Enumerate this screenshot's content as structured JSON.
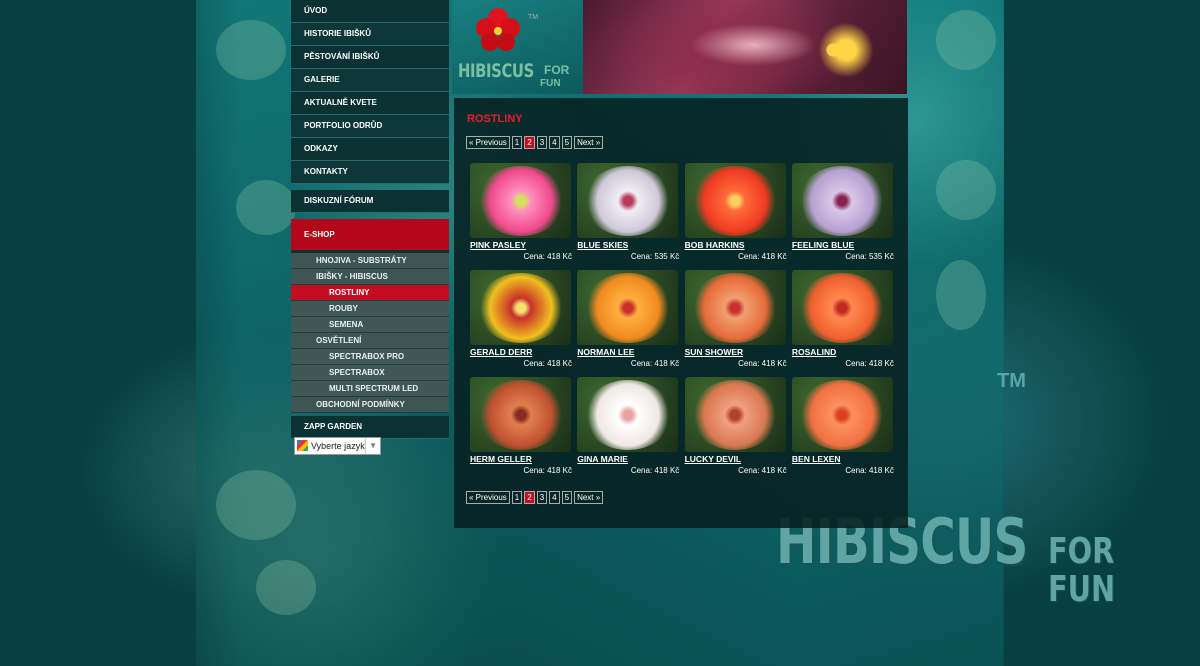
{
  "nav": {
    "top": [
      "ÚVOD",
      "HISTORIE IBIŠKŮ",
      "PĚSTOVÁNÍ IBIŠKŮ",
      "GALERIE",
      "AKTUALNĚ KVETE",
      "PORTFOLIO ODRŮD",
      "ODKAZY",
      "KONTAKTY"
    ],
    "forum": "DISKUZNÍ FÓRUM",
    "eshop": "E-SHOP",
    "sub": [
      {
        "label": "HNOJIVA - SUBSTRÁTY",
        "level": 1,
        "active": false
      },
      {
        "label": "IBIŠKY - HIBISCUS",
        "level": 1,
        "active": false
      },
      {
        "label": "ROSTLINY",
        "level": 2,
        "active": true
      },
      {
        "label": "ROUBY",
        "level": 2,
        "active": false
      },
      {
        "label": "SEMENA",
        "level": 2,
        "active": false
      },
      {
        "label": "OSVĚTLENÍ",
        "level": 1,
        "active": false
      },
      {
        "label": "SPECTRABOX PRO",
        "level": 2,
        "active": false
      },
      {
        "label": "SPECTRABOX",
        "level": 2,
        "active": false
      },
      {
        "label": "MULTI SPECTRUM LED",
        "level": 2,
        "active": false
      },
      {
        "label": "OBCHODNÍ PODMÍNKY",
        "level": 1,
        "active": false
      }
    ],
    "zapp": "ZAPP GARDEN",
    "language": "Vyberte jazyk"
  },
  "header": {
    "logo_main": "HIBISCUS",
    "logo_for": "FOR",
    "logo_fun": "FUN",
    "logo_tm": "TM"
  },
  "content": {
    "title": "ROSTLINY",
    "pager": {
      "prev": "« Previous",
      "pages": [
        "1",
        "2",
        "3",
        "4",
        "5"
      ],
      "current": "2",
      "next": "Next »"
    },
    "products": [
      {
        "name": "PINK PASLEY",
        "price": "Cena: 418 Kč",
        "colors": [
          "#f04a8a",
          "#ff8fc0",
          "#d8e060"
        ]
      },
      {
        "name": "BLUE SKIES",
        "price": "Cena: 535 Kč",
        "colors": [
          "#cfc8d8",
          "#f0eef5",
          "#b83a5a"
        ]
      },
      {
        "name": "BOB HARKINS",
        "price": "Cena: 418 Kč",
        "colors": [
          "#ef3a22",
          "#ff6a3a",
          "#ffd060"
        ]
      },
      {
        "name": "FEELING BLUE",
        "price": "Cena: 535 Kč",
        "colors": [
          "#b6a0d0",
          "#d8c8e8",
          "#8a2050"
        ]
      },
      {
        "name": "GERALD DERR",
        "price": "Cena: 418 Kč",
        "colors": [
          "#f0c020",
          "#c8302a",
          "#f8e070"
        ]
      },
      {
        "name": "NORMAN LEE",
        "price": "Cena: 418 Kč",
        "colors": [
          "#f08a20",
          "#ffb040",
          "#c8302a"
        ]
      },
      {
        "name": "SUN SHOWER",
        "price": "Cena: 418 Kč",
        "colors": [
          "#e86a3a",
          "#f0a070",
          "#c83030"
        ]
      },
      {
        "name": "ROSALIND",
        "price": "Cena: 418 Kč",
        "colors": [
          "#f06030",
          "#ff8850",
          "#c02820"
        ]
      },
      {
        "name": "HERM GELLER",
        "price": "Cena: 418 Kč",
        "colors": [
          "#c05030",
          "#e08050",
          "#8a2a20"
        ]
      },
      {
        "name": "GINA MARIE",
        "price": "Cena: 418 Kč",
        "colors": [
          "#f0e8e4",
          "#ffffff",
          "#e8a0a0"
        ]
      },
      {
        "name": "LUCKY DEVIL",
        "price": "Cena: 418 Kč",
        "colors": [
          "#d87850",
          "#f0a080",
          "#b04030"
        ]
      },
      {
        "name": "BEN LEXEN",
        "price": "Cena: 418 Kč",
        "colors": [
          "#f07040",
          "#ff9060",
          "#d84020"
        ]
      }
    ]
  },
  "watermark": {
    "big": "HIBISCUS",
    "for": "FOR",
    "fun": "FUN",
    "tm": "TM"
  }
}
